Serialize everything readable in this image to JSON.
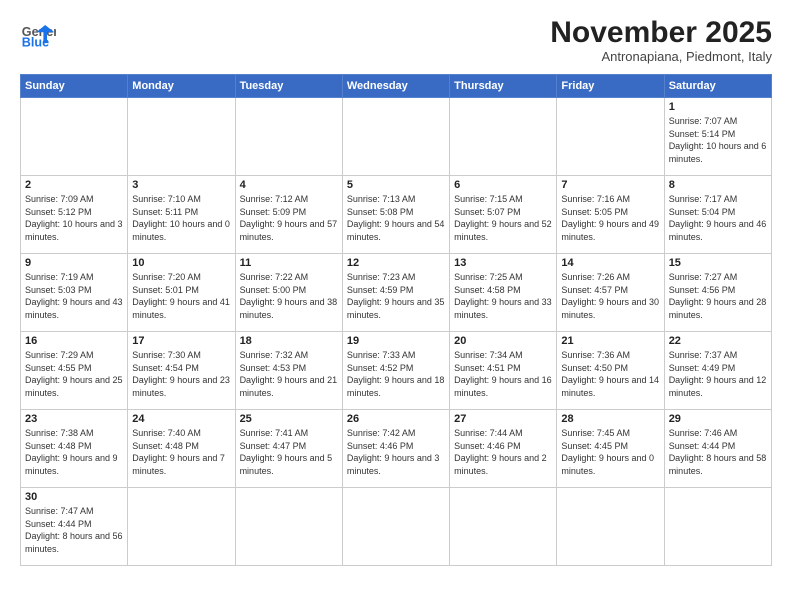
{
  "logo": {
    "text_general": "General",
    "text_blue": "Blue"
  },
  "title": "November 2025",
  "subtitle": "Antronapiana, Piedmont, Italy",
  "days_of_week": [
    "Sunday",
    "Monday",
    "Tuesday",
    "Wednesday",
    "Thursday",
    "Friday",
    "Saturday"
  ],
  "weeks": [
    [
      {
        "day": "",
        "info": ""
      },
      {
        "day": "",
        "info": ""
      },
      {
        "day": "",
        "info": ""
      },
      {
        "day": "",
        "info": ""
      },
      {
        "day": "",
        "info": ""
      },
      {
        "day": "",
        "info": ""
      },
      {
        "day": "1",
        "info": "Sunrise: 7:07 AM\nSunset: 5:14 PM\nDaylight: 10 hours and 6 minutes."
      }
    ],
    [
      {
        "day": "2",
        "info": "Sunrise: 7:09 AM\nSunset: 5:12 PM\nDaylight: 10 hours and 3 minutes."
      },
      {
        "day": "3",
        "info": "Sunrise: 7:10 AM\nSunset: 5:11 PM\nDaylight: 10 hours and 0 minutes."
      },
      {
        "day": "4",
        "info": "Sunrise: 7:12 AM\nSunset: 5:09 PM\nDaylight: 9 hours and 57 minutes."
      },
      {
        "day": "5",
        "info": "Sunrise: 7:13 AM\nSunset: 5:08 PM\nDaylight: 9 hours and 54 minutes."
      },
      {
        "day": "6",
        "info": "Sunrise: 7:15 AM\nSunset: 5:07 PM\nDaylight: 9 hours and 52 minutes."
      },
      {
        "day": "7",
        "info": "Sunrise: 7:16 AM\nSunset: 5:05 PM\nDaylight: 9 hours and 49 minutes."
      },
      {
        "day": "8",
        "info": "Sunrise: 7:17 AM\nSunset: 5:04 PM\nDaylight: 9 hours and 46 minutes."
      }
    ],
    [
      {
        "day": "9",
        "info": "Sunrise: 7:19 AM\nSunset: 5:03 PM\nDaylight: 9 hours and 43 minutes."
      },
      {
        "day": "10",
        "info": "Sunrise: 7:20 AM\nSunset: 5:01 PM\nDaylight: 9 hours and 41 minutes."
      },
      {
        "day": "11",
        "info": "Sunrise: 7:22 AM\nSunset: 5:00 PM\nDaylight: 9 hours and 38 minutes."
      },
      {
        "day": "12",
        "info": "Sunrise: 7:23 AM\nSunset: 4:59 PM\nDaylight: 9 hours and 35 minutes."
      },
      {
        "day": "13",
        "info": "Sunrise: 7:25 AM\nSunset: 4:58 PM\nDaylight: 9 hours and 33 minutes."
      },
      {
        "day": "14",
        "info": "Sunrise: 7:26 AM\nSunset: 4:57 PM\nDaylight: 9 hours and 30 minutes."
      },
      {
        "day": "15",
        "info": "Sunrise: 7:27 AM\nSunset: 4:56 PM\nDaylight: 9 hours and 28 minutes."
      }
    ],
    [
      {
        "day": "16",
        "info": "Sunrise: 7:29 AM\nSunset: 4:55 PM\nDaylight: 9 hours and 25 minutes."
      },
      {
        "day": "17",
        "info": "Sunrise: 7:30 AM\nSunset: 4:54 PM\nDaylight: 9 hours and 23 minutes."
      },
      {
        "day": "18",
        "info": "Sunrise: 7:32 AM\nSunset: 4:53 PM\nDaylight: 9 hours and 21 minutes."
      },
      {
        "day": "19",
        "info": "Sunrise: 7:33 AM\nSunset: 4:52 PM\nDaylight: 9 hours and 18 minutes."
      },
      {
        "day": "20",
        "info": "Sunrise: 7:34 AM\nSunset: 4:51 PM\nDaylight: 9 hours and 16 minutes."
      },
      {
        "day": "21",
        "info": "Sunrise: 7:36 AM\nSunset: 4:50 PM\nDaylight: 9 hours and 14 minutes."
      },
      {
        "day": "22",
        "info": "Sunrise: 7:37 AM\nSunset: 4:49 PM\nDaylight: 9 hours and 12 minutes."
      }
    ],
    [
      {
        "day": "23",
        "info": "Sunrise: 7:38 AM\nSunset: 4:48 PM\nDaylight: 9 hours and 9 minutes."
      },
      {
        "day": "24",
        "info": "Sunrise: 7:40 AM\nSunset: 4:48 PM\nDaylight: 9 hours and 7 minutes."
      },
      {
        "day": "25",
        "info": "Sunrise: 7:41 AM\nSunset: 4:47 PM\nDaylight: 9 hours and 5 minutes."
      },
      {
        "day": "26",
        "info": "Sunrise: 7:42 AM\nSunset: 4:46 PM\nDaylight: 9 hours and 3 minutes."
      },
      {
        "day": "27",
        "info": "Sunrise: 7:44 AM\nSunset: 4:46 PM\nDaylight: 9 hours and 2 minutes."
      },
      {
        "day": "28",
        "info": "Sunrise: 7:45 AM\nSunset: 4:45 PM\nDaylight: 9 hours and 0 minutes."
      },
      {
        "day": "29",
        "info": "Sunrise: 7:46 AM\nSunset: 4:44 PM\nDaylight: 8 hours and 58 minutes."
      }
    ],
    [
      {
        "day": "30",
        "info": "Sunrise: 7:47 AM\nSunset: 4:44 PM\nDaylight: 8 hours and 56 minutes."
      },
      {
        "day": "",
        "info": ""
      },
      {
        "day": "",
        "info": ""
      },
      {
        "day": "",
        "info": ""
      },
      {
        "day": "",
        "info": ""
      },
      {
        "day": "",
        "info": ""
      },
      {
        "day": "",
        "info": ""
      }
    ]
  ]
}
